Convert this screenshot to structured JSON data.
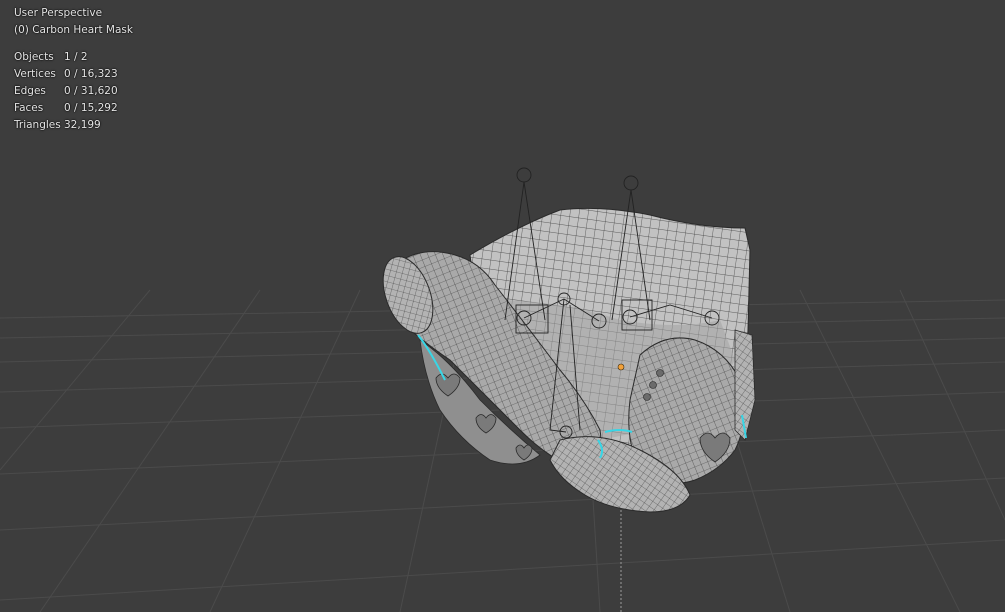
{
  "viewport": {
    "view_name": "User Perspective",
    "object_name": "(0) Carbon Heart Mask",
    "stats": [
      {
        "label": "Objects",
        "value": "1 / 2"
      },
      {
        "label": "Vertices",
        "value": "0 / 16,323"
      },
      {
        "label": "Edges",
        "value": "0 / 31,620"
      },
      {
        "label": "Faces",
        "value": "0 / 15,292"
      },
      {
        "label": "Triangles",
        "value": "32,199"
      }
    ]
  },
  "colors": {
    "background": "#3d3d3d",
    "grid_line": "#4a4a4a",
    "mesh_surface": "#b8b8b8",
    "mesh_wire": "#2a2a2a",
    "seam_highlight": "#38d6e6",
    "origin_dot": "#f2a13a",
    "text": "#e6e6e6"
  }
}
